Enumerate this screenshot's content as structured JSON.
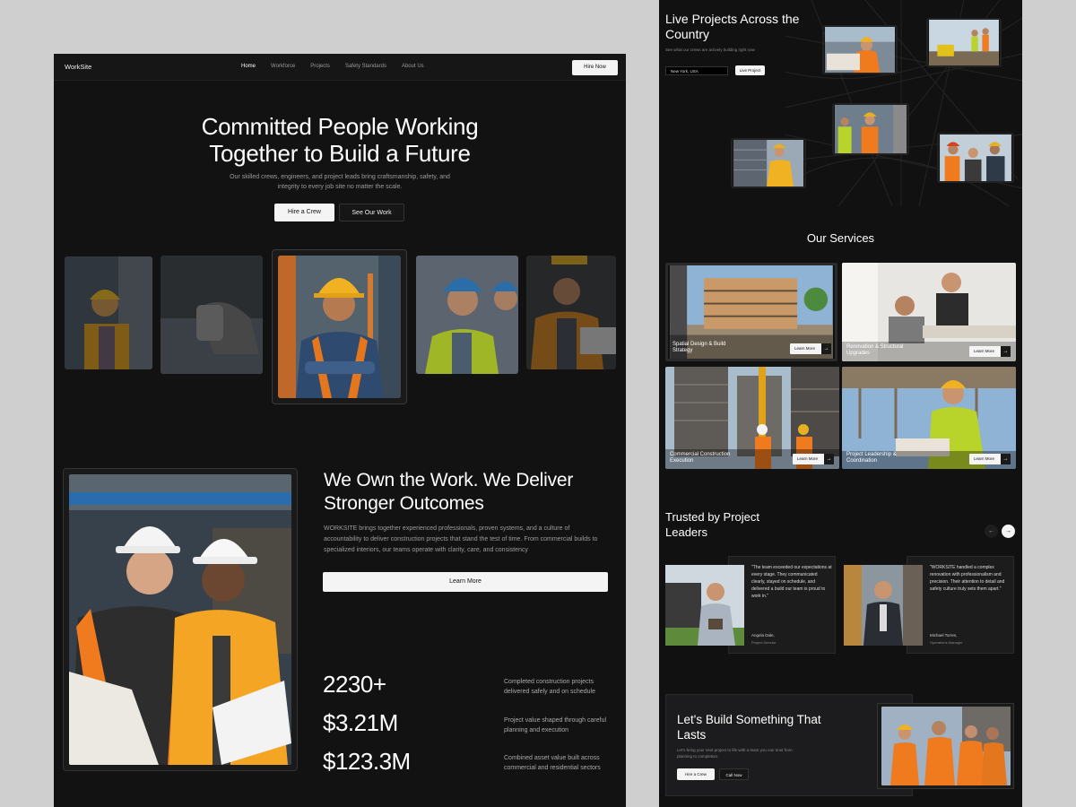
{
  "colors": {
    "background": "#121212",
    "accent": "#f4f4f4",
    "page": "#cfcfcf"
  },
  "nav": {
    "brand": "WorkSite",
    "links": [
      "Home",
      "Workforce",
      "Projects",
      "Safety Standards",
      "About Us"
    ],
    "cta": "Hire Now"
  },
  "hero": {
    "title_line1": "Committed People Working",
    "title_line2": "Together to Build a Future",
    "subtitle": "Our skilled crews, engineers, and project leads bring craftsmanship, safety, and integrity to every job site no matter the scale.",
    "primary_button": "Hire a Crew",
    "secondary_button": "See Our Work"
  },
  "about": {
    "title": "We Own the Work. We Deliver Stronger Outcomes",
    "text": "WORKSITE brings together experienced professionals, proven systems, and a culture of accountability to deliver construction projects that stand the test of time. From commercial builds to specialized interiors, our teams operate with clarity, care, and consistency",
    "button": "Learn More"
  },
  "stats": [
    {
      "value": "2230+",
      "desc": "Completed construction projects delivered safely and on schedule"
    },
    {
      "value": "$3.21M",
      "desc": "Project value shaped through careful planning and execution"
    },
    {
      "value": "$123.3M",
      "desc": "Combined asset value built across commercial and residential sectors"
    }
  ],
  "live": {
    "title": "Live Projects Across the Country",
    "subtitle": "See what our crews are actively building right now",
    "location": "New York, USA",
    "button": "Live Project"
  },
  "services": {
    "title": "Our Services",
    "button": "Learn More",
    "items": [
      {
        "label": "Spatial Design & Build Strategy"
      },
      {
        "label": "Renovation & Structural Upgrades"
      },
      {
        "label": "Commercial Construction Execution"
      },
      {
        "label": "Project Leadership & Coordination"
      }
    ]
  },
  "testimonials": {
    "title": "Trusted by Project Leaders",
    "prev_icon": "arrow-left-icon",
    "next_icon": "arrow-right-icon",
    "items": [
      {
        "quote": "\"The team exceeded our expectations at every stage. They communicated clearly, stayed on schedule, and delivered a build our team is proud to work in.\"",
        "name": "Angela Dale,",
        "role": "Project Director"
      },
      {
        "quote": "\"WORKSITE handled a complex renovation with professionalism and precision. Their attention to detail and safety culture truly sets them apart.\"",
        "name": "Michael Torres,",
        "role": "Operations Manager"
      }
    ]
  },
  "cta": {
    "title": "Let's Build Something That Lasts",
    "subtitle": "Let's bring your next project to life with a team you can trust from planning to completion.",
    "primary_button": "Hire a Crew",
    "secondary_button": "Call Now"
  }
}
